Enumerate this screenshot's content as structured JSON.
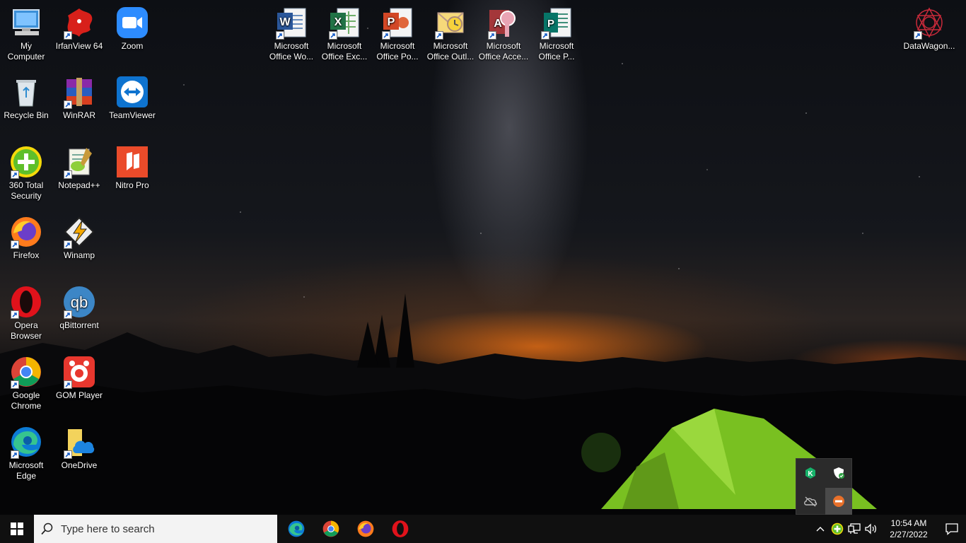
{
  "desktop_icons": [
    {
      "id": "my-computer",
      "label": "My Computer",
      "shortcut": false
    },
    {
      "id": "recycle-bin",
      "label": "Recycle Bin",
      "shortcut": false
    },
    {
      "id": "360-total-security",
      "label": "360 Total Security",
      "shortcut": true
    },
    {
      "id": "firefox",
      "label": "Firefox",
      "shortcut": true
    },
    {
      "id": "opera-browser",
      "label": "Opera Browser",
      "shortcut": true
    },
    {
      "id": "google-chrome",
      "label": "Google Chrome",
      "shortcut": true
    },
    {
      "id": "microsoft-edge",
      "label": "Microsoft Edge",
      "shortcut": true
    },
    {
      "id": "irfanview",
      "label": "IrfanView 64",
      "shortcut": true
    },
    {
      "id": "winrar",
      "label": "WinRAR",
      "shortcut": true
    },
    {
      "id": "notepadpp",
      "label": "Notepad++",
      "shortcut": true
    },
    {
      "id": "winamp",
      "label": "Winamp",
      "shortcut": true
    },
    {
      "id": "qbittorrent",
      "label": "qBittorrent",
      "shortcut": true
    },
    {
      "id": "gom-player",
      "label": "GOM Player",
      "shortcut": true
    },
    {
      "id": "onedrive",
      "label": "OneDrive",
      "shortcut": true
    },
    {
      "id": "zoom",
      "label": "Zoom",
      "shortcut": false
    },
    {
      "id": "teamviewer",
      "label": "TeamViewer",
      "shortcut": false
    },
    {
      "id": "nitro-pro",
      "label": "Nitro Pro",
      "shortcut": false
    },
    {
      "id": "ms-word",
      "label": "Microsoft Office Wo...",
      "shortcut": true
    },
    {
      "id": "ms-excel",
      "label": "Microsoft Office Exc...",
      "shortcut": true
    },
    {
      "id": "ms-powerpoint",
      "label": "Microsoft Office Po...",
      "shortcut": true
    },
    {
      "id": "ms-outlook",
      "label": "Microsoft Office Outl...",
      "shortcut": true
    },
    {
      "id": "ms-access",
      "label": "Microsoft Office Acce...",
      "shortcut": true
    },
    {
      "id": "ms-publisher",
      "label": "Microsoft Office P...",
      "shortcut": true
    },
    {
      "id": "datawagon",
      "label": "DataWagon...",
      "shortcut": true
    }
  ],
  "taskbar": {
    "search_placeholder": "Type here to search",
    "pinned": [
      "edge-icon",
      "chrome-icon",
      "firefox-icon",
      "opera-icon"
    ],
    "clock": {
      "time": "10:54 AM",
      "date": "2/27/2022"
    }
  },
  "tray_popup": [
    "kaspersky-icon",
    "defender-icon",
    "onedrive-offline-icon",
    "firewall-icon"
  ],
  "colors": {
    "taskbar": "#101010",
    "search_bg": "#f3f3f3",
    "tent_green": "#7ec623"
  }
}
